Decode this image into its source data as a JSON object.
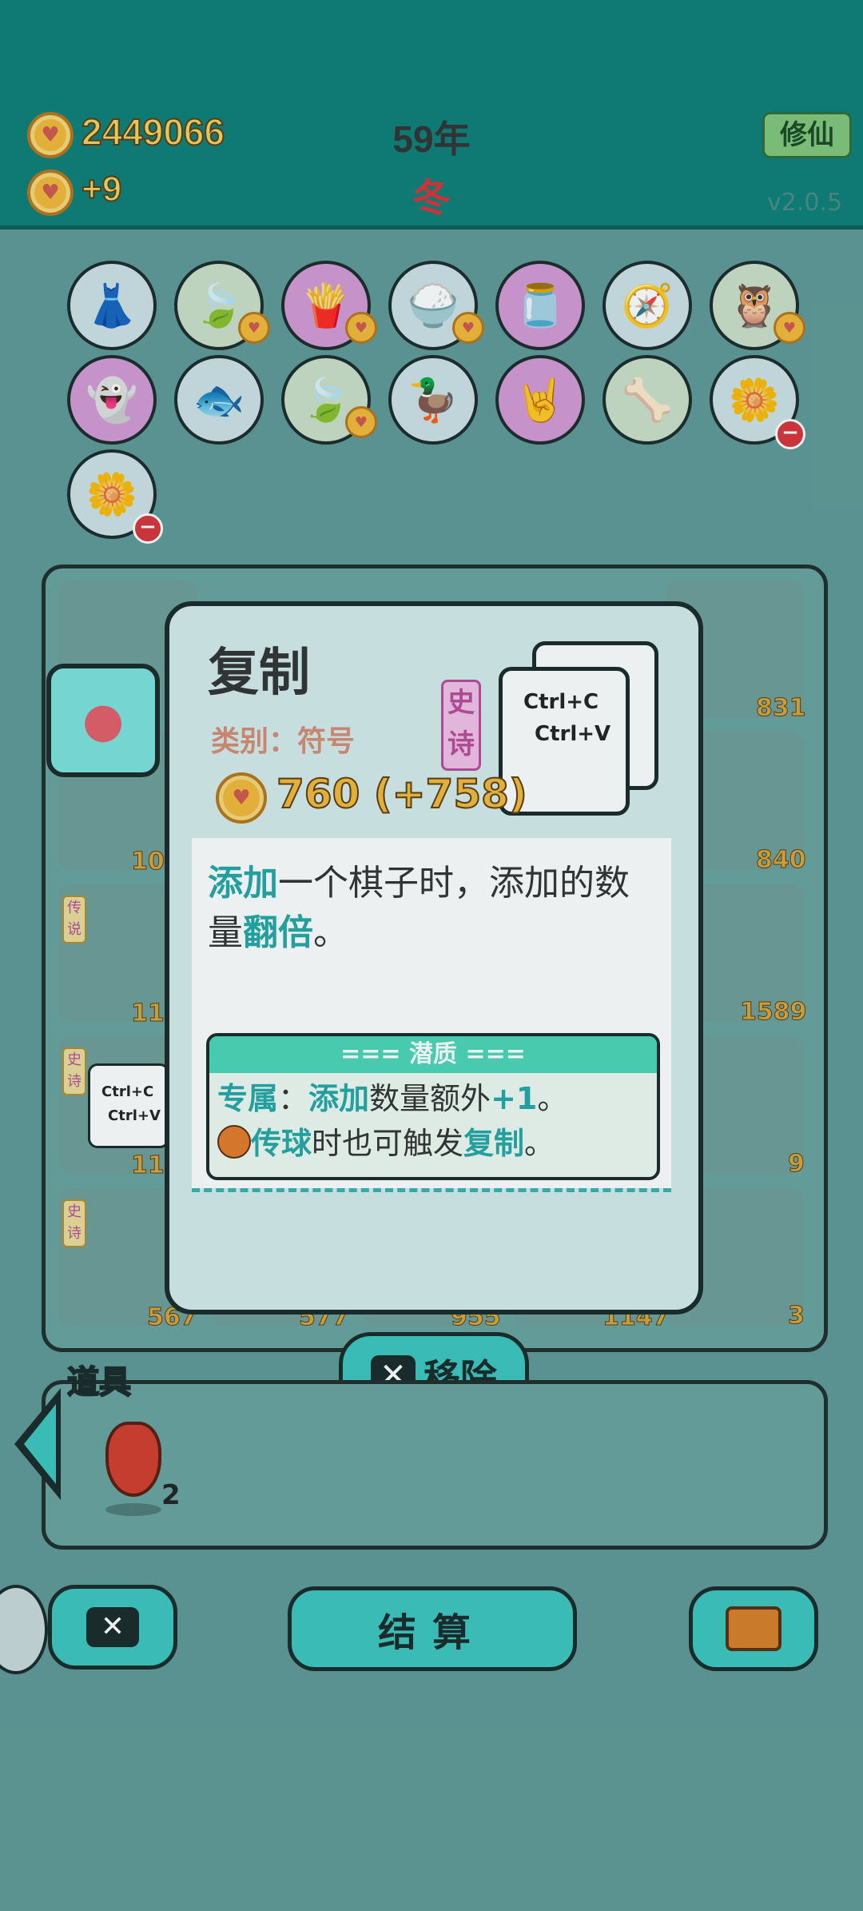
{
  "header": {
    "coins": "2449066",
    "income": "+9",
    "year": "59年",
    "season": "冬",
    "cultivate_button": "修仙",
    "version": "v2.0.5"
  },
  "inventory_icons": [
    {
      "name": "skirt-icon",
      "glyph": "👗",
      "color": "#cfe2e8"
    },
    {
      "name": "leaf-icon",
      "glyph": "🍃",
      "color": "#cde0c8"
    },
    {
      "name": "fries-icon",
      "glyph": "🍟",
      "color": "#d59ad6"
    },
    {
      "name": "rice-bowl-icon",
      "glyph": "🍚",
      "color": "#cfe2e8"
    },
    {
      "name": "jar-icon",
      "glyph": "🫙",
      "color": "#d59ad6"
    },
    {
      "name": "compass-icon",
      "glyph": "🧭",
      "color": "#cfe2e8"
    },
    {
      "name": "owl-icon",
      "glyph": "🦉",
      "color": "#cde0c8"
    },
    {
      "name": "ghost-icon",
      "glyph": "👻",
      "color": "#d59ad6"
    },
    {
      "name": "fishbowl-icon",
      "glyph": "🐟",
      "color": "#cfe2e8"
    },
    {
      "name": "leaf-icon",
      "glyph": "🍃",
      "color": "#cde0c8"
    },
    {
      "name": "duck-pot-icon",
      "glyph": "🦆",
      "color": "#cfe2e8"
    },
    {
      "name": "rock-hand-icon",
      "glyph": "🤘",
      "color": "#d59ad6"
    },
    {
      "name": "dog-bowl-icon",
      "glyph": "🦴",
      "color": "#cde0c8"
    },
    {
      "name": "flower-pot-icon",
      "glyph": "🌼",
      "color": "#cfe2e8"
    },
    {
      "name": "flower-pot-icon",
      "glyph": "🌼",
      "color": "#cfe2e8"
    }
  ],
  "board": {
    "left_column_numbers": [
      "10",
      "11",
      "11"
    ],
    "left_tags": [
      "传说",
      "史诗",
      "史诗"
    ],
    "right_column_numbers": [
      "831",
      "840",
      "1589",
      "9",
      "3"
    ],
    "bottom_row_numbers": [
      "567",
      "577",
      "955",
      "1147"
    ],
    "card_ctrl_c": "Ctrl+C",
    "card_ctrl_v": "Ctrl+V"
  },
  "dialog": {
    "title": "复制",
    "category": "类别：符号",
    "rarity": "史诗",
    "price": "760 (+758)",
    "card_line1": "Ctrl+C",
    "card_line2": "Ctrl+V",
    "desc_hl1": "添加",
    "desc_mid": "一个棋子时，添加的数量",
    "desc_hl2": "翻倍",
    "desc_end": "。",
    "potential_title": "=== 潜质 ===",
    "pot_exclusive": "专属",
    "pot_colon": "：",
    "pot_add": "添加",
    "pot_mid": "数量额外",
    "pot_plus": "+1",
    "pot_end1": "。",
    "pot_pass": "传球",
    "pot_mid2": "时也可触发",
    "pot_copy": "复制",
    "pot_end2": "。"
  },
  "remove_button": "移除",
  "props": {
    "label": "道具",
    "pepper_count": "2"
  },
  "bottom": {
    "settle_label": "结算"
  },
  "colors": {
    "teal_header": "#0f7e78",
    "accent": "#3ec6c0",
    "highlight": "#24a8a8",
    "gold": "#f2b93a"
  }
}
